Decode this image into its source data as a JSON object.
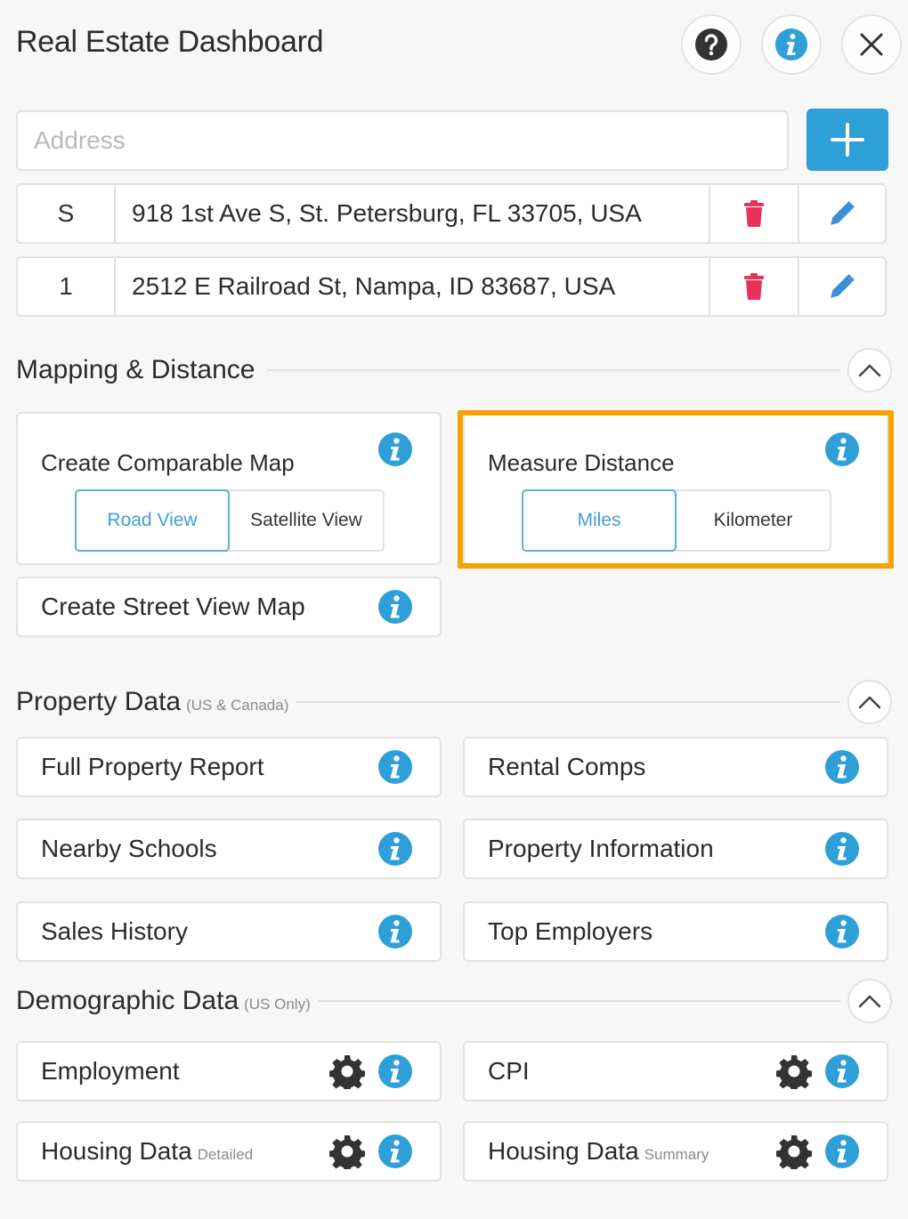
{
  "header": {
    "title": "Real Estate Dashboard",
    "buttons": [
      "help-icon",
      "info-icon",
      "close-icon"
    ]
  },
  "address_input": {
    "placeholder": "Address",
    "value": ""
  },
  "addresses": [
    {
      "id": "S",
      "address": "918 1st Ave S, St. Petersburg, FL 33705, USA"
    },
    {
      "id": "1",
      "address": "2512 E Railroad St, Nampa, ID 83687, USA"
    }
  ],
  "sections": {
    "mapping": {
      "title": "Mapping & Distance",
      "subtitle": "",
      "comparable_map": {
        "label": "Create Comparable Map",
        "options": [
          "Road View",
          "Satellite View"
        ],
        "selected": "Road View"
      },
      "measure_distance": {
        "label": "Measure Distance",
        "options": [
          "Miles",
          "Kilometer"
        ],
        "selected": "Miles"
      },
      "street_view": {
        "label": "Create Street View Map"
      }
    },
    "property": {
      "title": "Property Data",
      "subtitle": "(US & Canada)",
      "items": [
        {
          "label": "Full Property Report"
        },
        {
          "label": "Rental Comps"
        },
        {
          "label": "Nearby Schools"
        },
        {
          "label": "Property Information"
        },
        {
          "label": "Sales History"
        },
        {
          "label": "Top Employers"
        }
      ]
    },
    "demographic": {
      "title": "Demographic Data",
      "subtitle": "(US Only)",
      "items": [
        {
          "label": "Employment",
          "sub": ""
        },
        {
          "label": "CPI",
          "sub": ""
        },
        {
          "label": "Housing Data",
          "sub": "Detailed"
        },
        {
          "label": "Housing Data",
          "sub": "Summary"
        }
      ]
    }
  },
  "colors": {
    "accent_blue": "#2f9fd8",
    "info_blue": "#2f9fd8",
    "delete_red": "#e8325a",
    "edit_blue": "#3a8fd6",
    "highlight_orange": "#f5a300",
    "gear": "#333333"
  }
}
